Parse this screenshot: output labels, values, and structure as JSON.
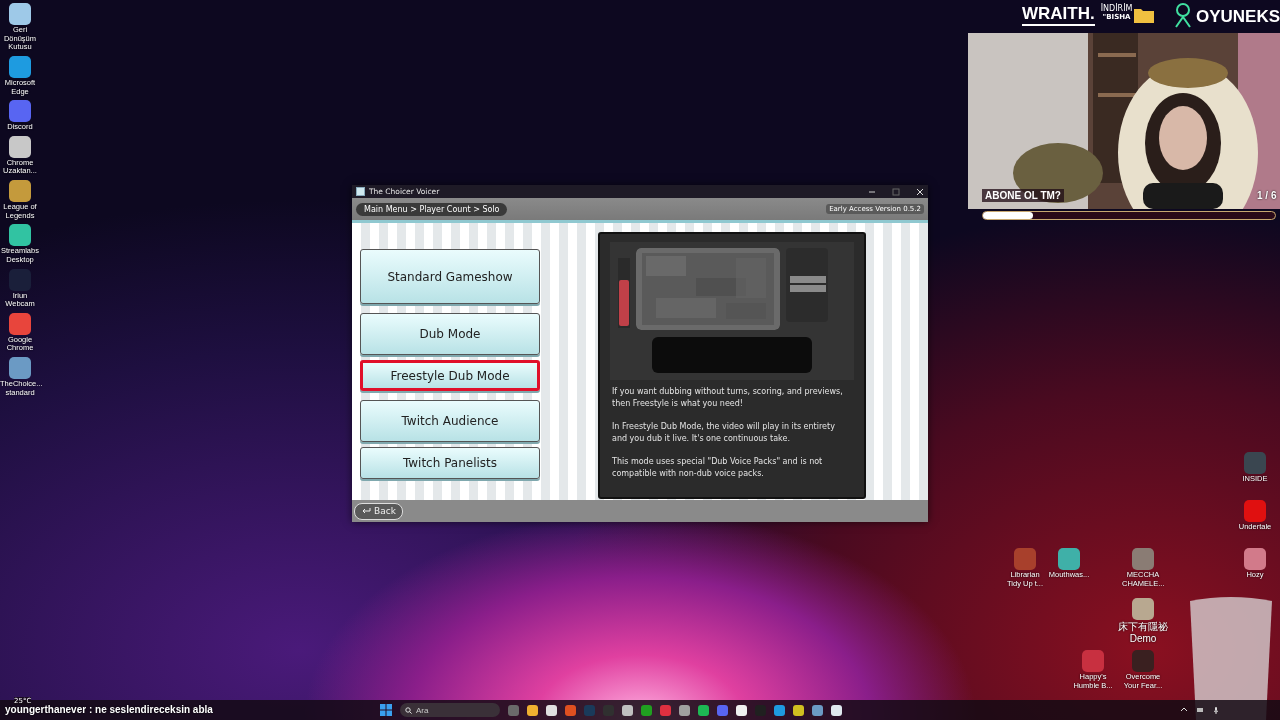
{
  "desktop_icons": [
    {
      "label": "Geri Dönüşüm Kutusu",
      "color": "#9ec9e8"
    },
    {
      "label": "Microsoft Edge",
      "color": "#1e9be0"
    },
    {
      "label": "Discord",
      "color": "#5865f2"
    },
    {
      "label": "Chrome Uzaktan...",
      "color": "#c8c8c8"
    },
    {
      "label": "League of Legends",
      "color": "#c49a3c"
    },
    {
      "label": "Streamlabs Desktop",
      "color": "#31c3a2"
    },
    {
      "label": "Iriun Webcam",
      "color": "#1a1f3a"
    },
    {
      "label": "Google Chrome",
      "color": "#e8453c"
    },
    {
      "label": "TheChoice... standard",
      "color": "#6b9ac4"
    }
  ],
  "right_icons": [
    {
      "label": "INSIDE",
      "color": "#3a4650"
    },
    {
      "label": "Undertale",
      "color": "#e01010"
    },
    {
      "label": "Librarian Tidy Up t...",
      "color": "#a8402c"
    },
    {
      "label": "Mouthwas...",
      "color": "#3fb0a8"
    },
    {
      "label": "MECCHA CHAMELE...",
      "color": "#8a7c74"
    },
    {
      "label": "Hozy",
      "color": "#d27a8a"
    },
    {
      "label": "床下有隱祕 Demo",
      "color": "#b8a890"
    },
    {
      "label": "Happy's Humble B...",
      "color": "#c83040"
    },
    {
      "label": "Overcome Your Fear...",
      "color": "#3a2020"
    }
  ],
  "window": {
    "title": "The Choicer Voicer",
    "breadcrumb": "Main Menu > Player Count > Solo",
    "version": "Early Access Version 0.5.2",
    "modes": [
      {
        "label": "Standard Gameshow",
        "selected": false
      },
      {
        "label": "Dub Mode",
        "selected": false
      },
      {
        "label": "Freestyle Dub Mode",
        "selected": true
      },
      {
        "label": "Twitch Audience",
        "selected": false
      },
      {
        "label": "Twitch Panelists",
        "selected": false
      }
    ],
    "description": [
      "If you want dubbing without turns, scoring, and previews, then Freestyle is what you need!",
      "In Freestyle Dub Mode, the video will play in its entirety and you dub it live. It's one continuous take.",
      "This mode uses special \"Dub Voice Packs\" and is not compatible with non-dub voice packs."
    ],
    "back": "Back"
  },
  "stream_overlay": {
    "sponsor": "WRAITH.",
    "promo": "İNDİRİM",
    "code": "\"BISHA",
    "brand": "OYUNEKS",
    "poll": {
      "question": "ABONE OL TM?",
      "counter": "1 / 6",
      "level": 0.17
    }
  },
  "chat_line": "youngerthanever : ne seslendireceksin abla",
  "taskbar": {
    "weather": "25°C",
    "search": {
      "placeholder": "Ara"
    },
    "apps": [
      {
        "color": "#6a6a6a"
      },
      {
        "color": "#f0b030"
      },
      {
        "color": "#e0e0e0"
      },
      {
        "color": "#e05020"
      },
      {
        "color": "#1a3a5a"
      },
      {
        "color": "#303030"
      },
      {
        "color": "#c0c0c0"
      },
      {
        "color": "#20a020"
      },
      {
        "color": "#e03040"
      },
      {
        "color": "#a0a0a0"
      },
      {
        "color": "#1db954"
      },
      {
        "color": "#5865f2"
      },
      {
        "color": "#f0f0f0"
      },
      {
        "color": "#202020"
      },
      {
        "color": "#1e9be0"
      },
      {
        "color": "#d0c020"
      },
      {
        "color": "#6b9ac4"
      },
      {
        "color": "#dfe8ee"
      }
    ]
  }
}
